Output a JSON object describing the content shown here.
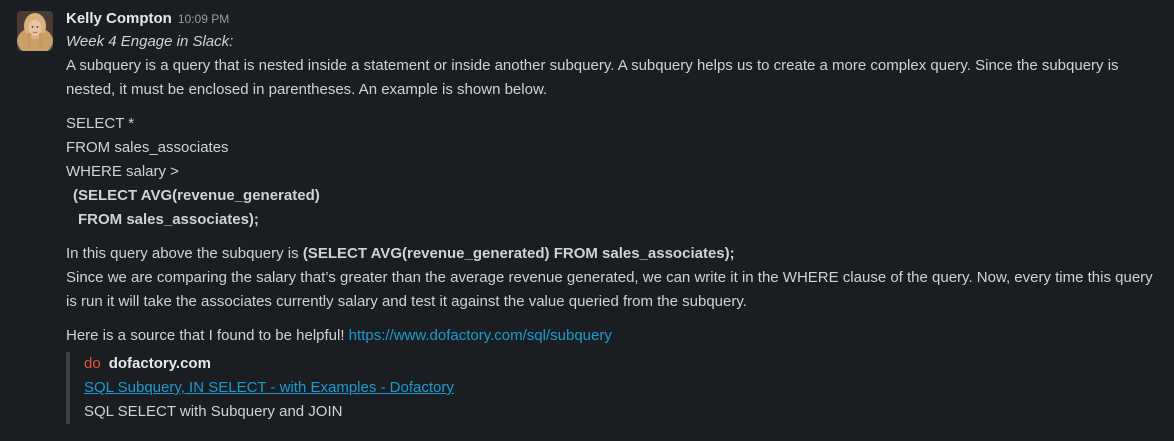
{
  "message": {
    "author": "Kelly Compton",
    "timestamp": "10:09 PM",
    "intro_title": "Week 4 Engage in Slack:",
    "paragraph1": "A subquery is a query that is nested inside a statement or inside another subquery. A subquery helps us to create a more complex query. Since the subquery is nested, it must be enclosed in parentheses. An example is shown below.",
    "code": {
      "line1": "SELECT *",
      "line2": "FROM sales_associates",
      "line3": "WHERE salary >",
      "line4": "(SELECT AVG(revenue_generated)",
      "line5": "FROM sales_associates);"
    },
    "explain_prefix": "In this query above the subquery is ",
    "explain_bold": "(SELECT AVG(revenue_generated) FROM sales_associates);",
    "paragraph2": "Since we are comparing the salary that’s greater than the average revenue generated, we can write it in the WHERE clause of the query. Now, every time this query is run it will take the associates currently salary and test it against the value queried from the subquery.",
    "source_prefix": "Here is a source that I found to be helpful! ",
    "source_link": "https://www.dofactory.com/sql/subquery",
    "unfurl": {
      "logo_text": "do",
      "site_name": "dofactory.com",
      "title": "SQL Subquery, IN SELECT - with Examples - Dofactory",
      "description": "SQL SELECT with Subquery and JOIN"
    }
  },
  "colors": {
    "background": "#1a1d21",
    "text": "#d1d2d3",
    "link": "#1d9bd1",
    "logo": "#e8543a"
  }
}
